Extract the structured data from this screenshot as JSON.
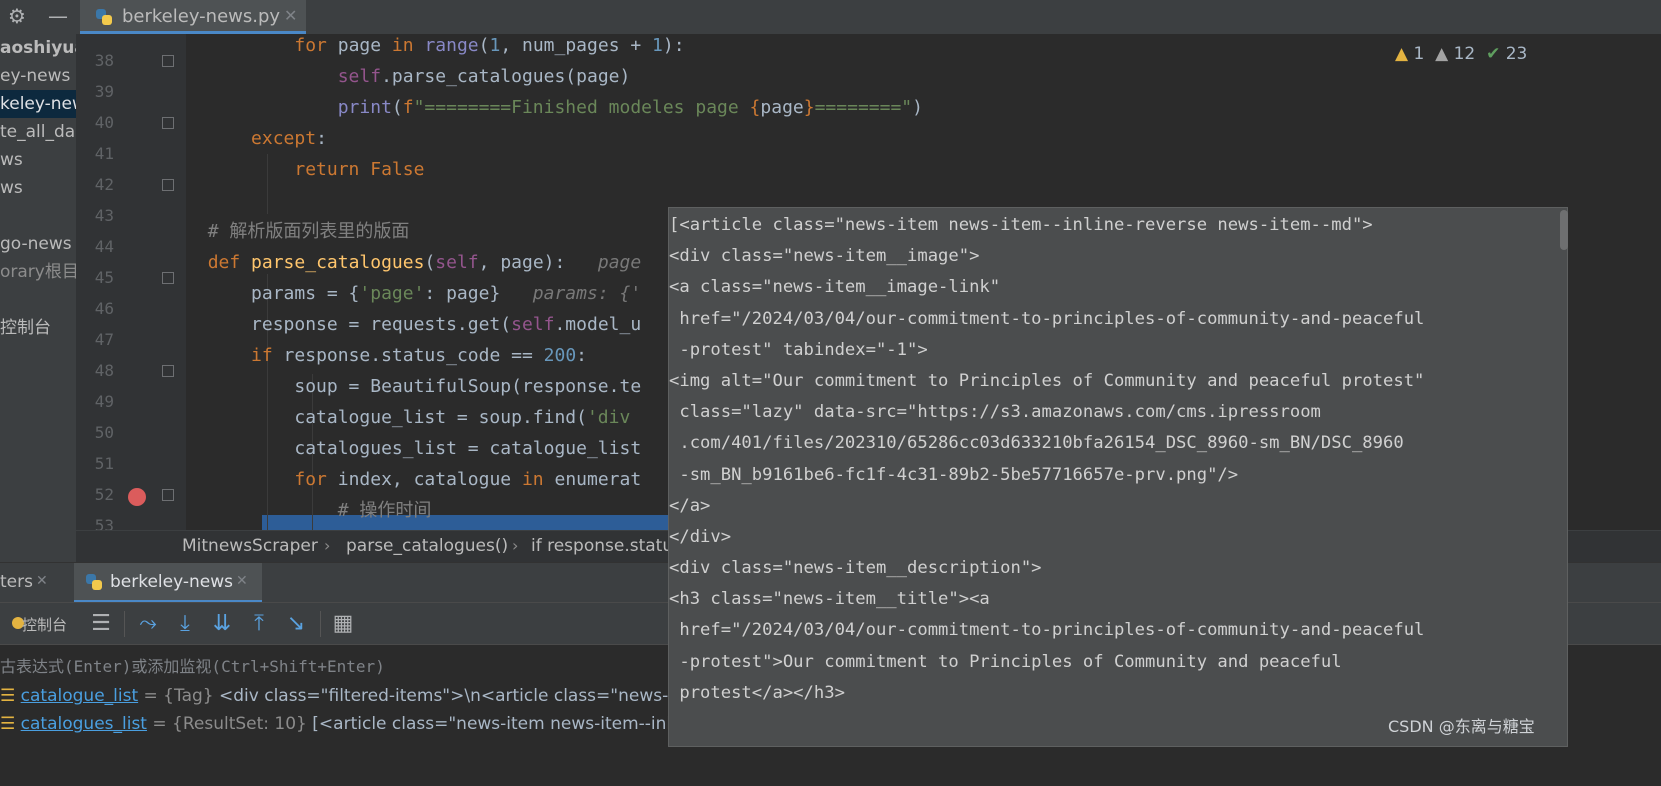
{
  "editor_tab": {
    "filename": "berkeley-news.py",
    "close_glyph": "✕"
  },
  "toolbar_glyphs": {
    "gear": "⚙",
    "minimize": "—"
  },
  "project_tree": [
    {
      "label": "aoshiyua",
      "style": "bold"
    },
    {
      "label": "ey-news",
      "style": "normal"
    },
    {
      "label": "keley-new",
      "style": "sel"
    },
    {
      "label": "te_all_da",
      "style": "normal"
    },
    {
      "label": "ws",
      "style": "normal"
    },
    {
      "label": "ws",
      "style": "normal"
    },
    {
      "label": "",
      "style": "normal"
    },
    {
      "label": "go-news",
      "style": "normal"
    },
    {
      "label": "orary根目",
      "style": "dim"
    },
    {
      "label": "",
      "style": "normal"
    },
    {
      "label": "控制台",
      "style": "normal"
    }
  ],
  "line_numbers": [
    "38",
    "39",
    "40",
    "41",
    "42",
    "43",
    "44",
    "45",
    "46",
    "47",
    "48",
    "49",
    "50",
    "51",
    "52",
    "53"
  ],
  "inspections": {
    "warnings": "1",
    "weak_warnings": "12",
    "typos": "23"
  },
  "breadcrumb": [
    "MitnewsScraper",
    "parse_catalogues()",
    "if response.status"
  ],
  "debug_tabs": [
    {
      "label": "ters",
      "close": "✕"
    },
    {
      "label": "berkeley-news",
      "close": "✕"
    }
  ],
  "debug_toolbar": {
    "console_label": "控制台"
  },
  "watch_placeholder": "古表达式(Enter)或添加监视(Ctrl+Shift+Enter)",
  "variables": [
    {
      "name": "catalogue_list",
      "type": "= {Tag}",
      "value": " <div class=\"filtered-items\">\\n<article class=\"news-item "
    },
    {
      "name": "catalogues_list",
      "type": "= {ResultSet: 10}",
      "value": " [<article class=\"news-item news-item--inline-reverse news-item--md\">\\n<div class=\"news-item__image\">\\n<a class=\"news-item__image-link"
    }
  ],
  "popup_lines": [
    "[<article class=\"news-item news-item--inline-reverse news-item--md\">",
    "<div class=\"news-item__image\">",
    "<a class=\"news-item__image-link\"",
    " href=\"/2024/03/04/our-commitment-to-principles-of-community-and-peaceful",
    " -protest\" tabindex=\"-1\">",
    "<img alt=\"Our commitment to Principles of Community and peaceful protest\"",
    " class=\"lazy\" data-src=\"https://s3.amazonaws.com/cms.ipressroom",
    " .com/401/files/202310/65286cc03d633210bfa26154_DSC_8960-sm_BN/DSC_8960",
    " -sm_BN_b9161be6-fc1f-4c31-89b2-5be57716657e-prv.png\"/>",
    "</a>",
    "</div>",
    "<div class=\"news-item__description\">",
    "<h3 class=\"news-item__title\"><a",
    " href=\"/2024/03/04/our-commitment-to-principles-of-community-and-peaceful",
    " -protest\">Our commitment to Principles of Community and peaceful",
    " protest</a></h3>",
    " "
  ],
  "watermark": "CSDN @东离与糖宝"
}
